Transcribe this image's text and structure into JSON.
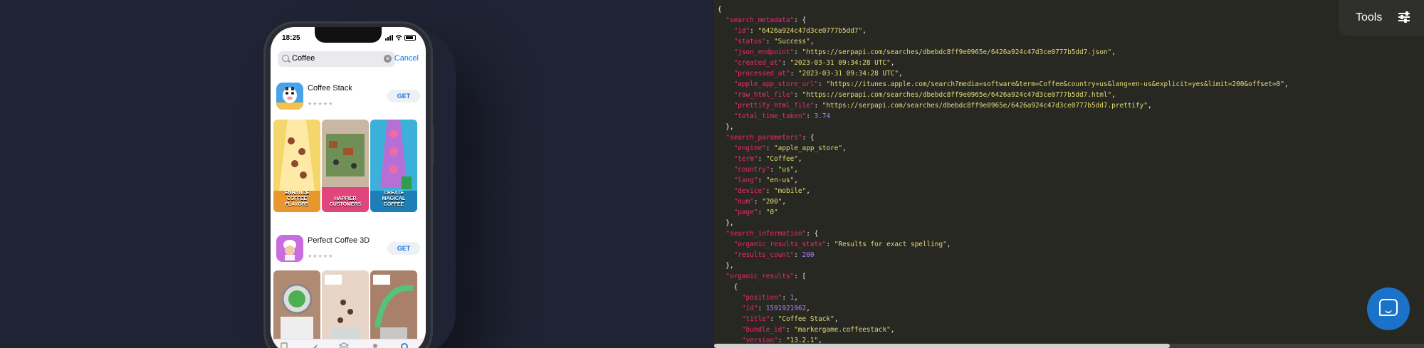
{
  "phone": {
    "time": "18:25",
    "search_value": "Coffee",
    "cancel_label": "Cancel",
    "apps": [
      {
        "name": "Coffee Stack",
        "get_label": "GET",
        "screenshots": [
          {
            "caption": "ENHANCE COFFEE FLAVORS"
          },
          {
            "caption": "HAPPIER CUSTOMERS"
          },
          {
            "caption": "CREATE MAGICAL COFFEE"
          }
        ]
      },
      {
        "name": "Perfect Coffee 3D",
        "get_label": "GET"
      }
    ]
  },
  "tools": {
    "label": "Tools"
  },
  "json_lines": [
    "{",
    "  \"search_metadata\": {",
    "    \"id\": \"6426a924c47d3ce0777b5dd7\",",
    "    \"status\": \"Success\",",
    "    \"json_endpoint\": \"https://serpapi.com/searches/dbebdc8ff9e0965e/6426a924c47d3ce0777b5dd7.json\",",
    "    \"created_at\": \"2023-03-31 09:34:28 UTC\",",
    "    \"processed_at\": \"2023-03-31 09:34:28 UTC\",",
    "    \"apple_app_store_url\": \"https://itunes.apple.com/search?media=software&term=Coffee&country=us&lang=en-us&explicit=yes&limit=200&offset=0\",",
    "    \"raw_html_file\": \"https://serpapi.com/searches/dbebdc8ff9e0965e/6426a924c47d3ce0777b5dd7.html\",",
    "    \"prettify_html_file\": \"https://serpapi.com/searches/dbebdc8ff9e0965e/6426a924c47d3ce0777b5dd7.prettify\",",
    "    \"total_time_taken\": 3.74",
    "  },",
    "  \"search_parameters\": {",
    "    \"engine\": \"apple_app_store\",",
    "    \"term\": \"Coffee\",",
    "    \"country\": \"us\",",
    "    \"lang\": \"en-us\",",
    "    \"device\": \"mobile\",",
    "    \"num\": \"200\",",
    "    \"page\": \"0\"",
    "  },",
    "  \"search_information\": {",
    "    \"organic_results_state\": \"Results for exact spelling\",",
    "    \"results_count\": 200",
    "  },",
    "  \"organic_results\": [",
    "    {",
    "      \"position\": 1,",
    "      \"id\": 1591921962,",
    "      \"title\": \"Coffee Stack\",",
    "      \"bundle_id\": \"markergame.coffeestack\",",
    "      \"version\": \"13.2.1\","
  ]
}
